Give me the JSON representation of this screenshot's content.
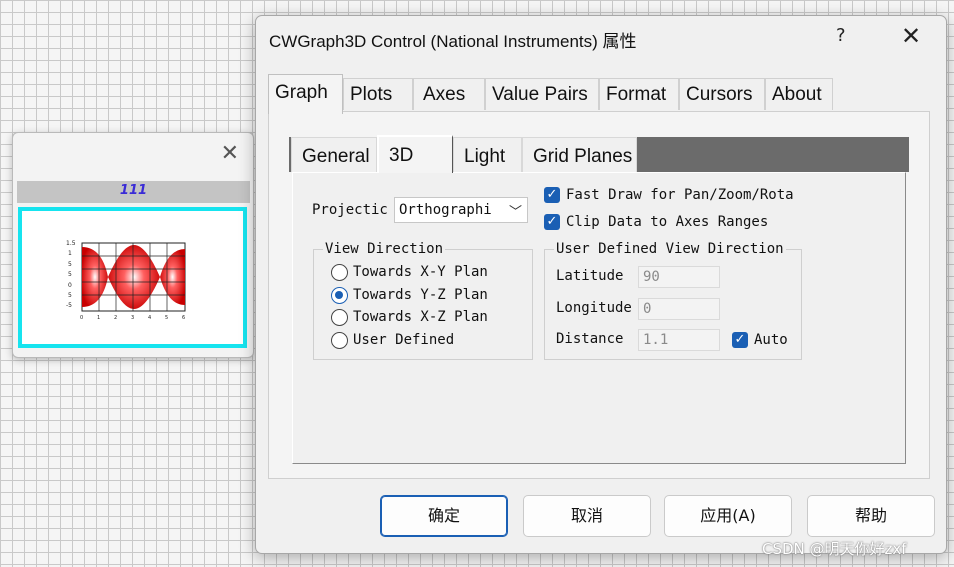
{
  "mini_window": {
    "close_glyph": "✕",
    "caption": "111",
    "graph_y_ticks": [
      "1.5",
      "1",
      "5",
      "5",
      "0",
      "5",
      "-5",
      "-1"
    ],
    "graph_x_ticks": [
      "0",
      "1",
      "2",
      "3",
      "4",
      "5",
      "6"
    ]
  },
  "dialog": {
    "title": "CWGraph3D Control  (National Instruments) 属性",
    "help_glyph": "?",
    "close_glyph": "✕",
    "tabs": [
      {
        "label": "Graph"
      },
      {
        "label": "Plots"
      },
      {
        "label": "Axes"
      },
      {
        "label": "Value Pairs"
      },
      {
        "label": "Format"
      },
      {
        "label": "Cursors"
      },
      {
        "label": "About"
      }
    ],
    "active_tab": "Graph",
    "subtabs": [
      {
        "label": "General"
      },
      {
        "label": "3D"
      },
      {
        "label": "Light"
      },
      {
        "label": "Grid Planes"
      }
    ],
    "active_subtab": "3D",
    "projection": {
      "label": "Projectic",
      "value": "Orthographi"
    },
    "checks": {
      "fast_draw": {
        "label": "Fast Draw for Pan/Zoom/Rota",
        "checked": true
      },
      "clip_data": {
        "label": "Clip Data to Axes Ranges",
        "checked": true
      }
    },
    "view_direction": {
      "title": "View Direction",
      "options": [
        {
          "label": "Towards X-Y Plan",
          "selected": false
        },
        {
          "label": "Towards Y-Z Plan",
          "selected": true
        },
        {
          "label": "Towards X-Z Plan",
          "selected": false
        },
        {
          "label": "User Defined",
          "selected": false
        }
      ]
    },
    "user_defined": {
      "title": "User Defined View Direction",
      "latitude_label": "Latitude",
      "latitude_value": "90",
      "longitude_label": "Longitude",
      "longitude_value": "0",
      "distance_label": "Distance",
      "distance_value": "1.1",
      "auto_label": "Auto",
      "auto_checked": true
    },
    "buttons": {
      "ok": "确定",
      "cancel": "取消",
      "apply": "应用(A)",
      "help": "帮助"
    }
  },
  "watermark": "CSDN @明天你好zxf",
  "colors": {
    "accent": "#1a5fb4",
    "cyan_border": "#16e4ef",
    "caption_blue": "#3a2bd6",
    "plot_red": "#e00000"
  }
}
